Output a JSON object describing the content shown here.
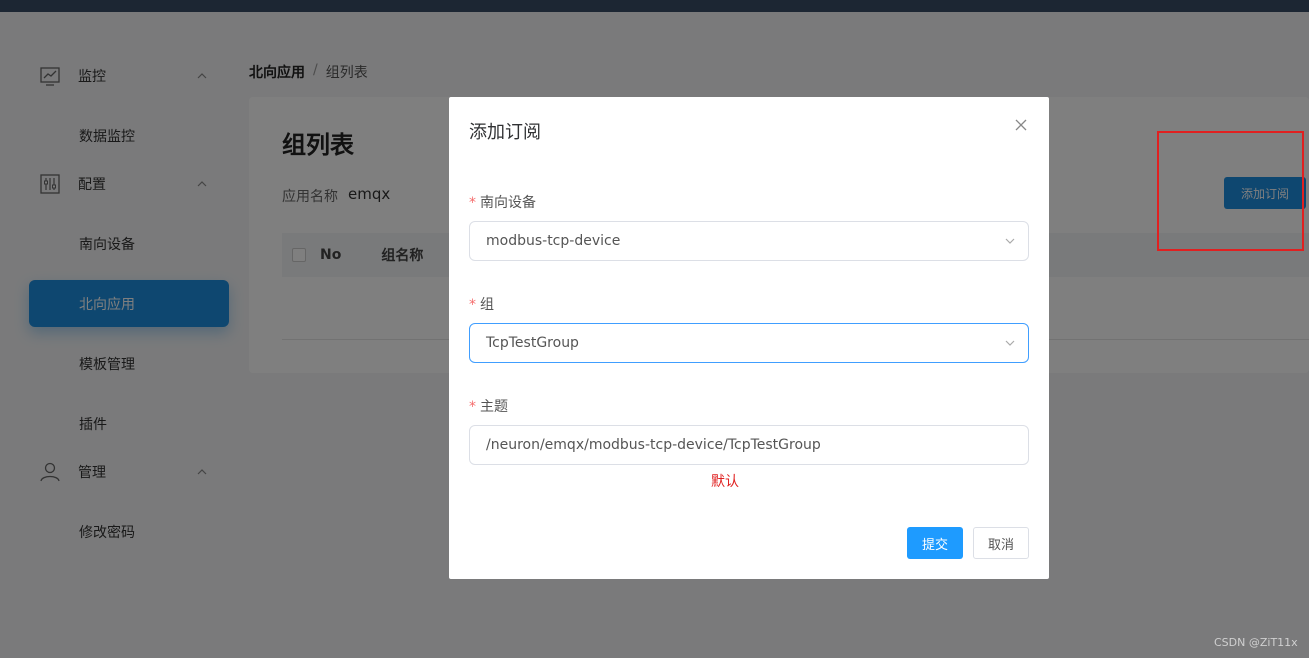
{
  "sidebar": {
    "groups": [
      {
        "label": "监控",
        "icon": "monitor-chart-icon",
        "items": [
          "数据监控"
        ]
      },
      {
        "label": "配置",
        "icon": "config-sliders-icon",
        "items": [
          "南向设备",
          "北向应用",
          "模板管理",
          "插件"
        ]
      },
      {
        "label": "管理",
        "icon": "user-icon",
        "items": [
          "修改密码"
        ]
      }
    ],
    "active_item": "北向应用"
  },
  "breadcrumb": {
    "parent": "北向应用",
    "separator": "/",
    "current": "组列表"
  },
  "page": {
    "title": "组列表",
    "app_name_label": "应用名称",
    "app_name_value": "emqx",
    "add_subscription_button": "添加订阅",
    "table_headers": [
      "No",
      "组名称"
    ]
  },
  "dialog": {
    "title": "添加订阅",
    "fields": {
      "device": {
        "label": "南向设备",
        "value": "modbus-tcp-device"
      },
      "group": {
        "label": "组",
        "value": "TcpTestGroup"
      },
      "topic": {
        "label": "主题",
        "value": "/neuron/emqx/modbus-tcp-device/TcpTestGroup"
      }
    },
    "default_link": "默认",
    "submit_label": "提交",
    "cancel_label": "取消"
  },
  "watermark": "CSDN @ZiT11x",
  "colors": {
    "primary": "#1c8ee0",
    "required": "#f56c6c",
    "annotation": "#e02020",
    "focus_border": "#409eff"
  }
}
